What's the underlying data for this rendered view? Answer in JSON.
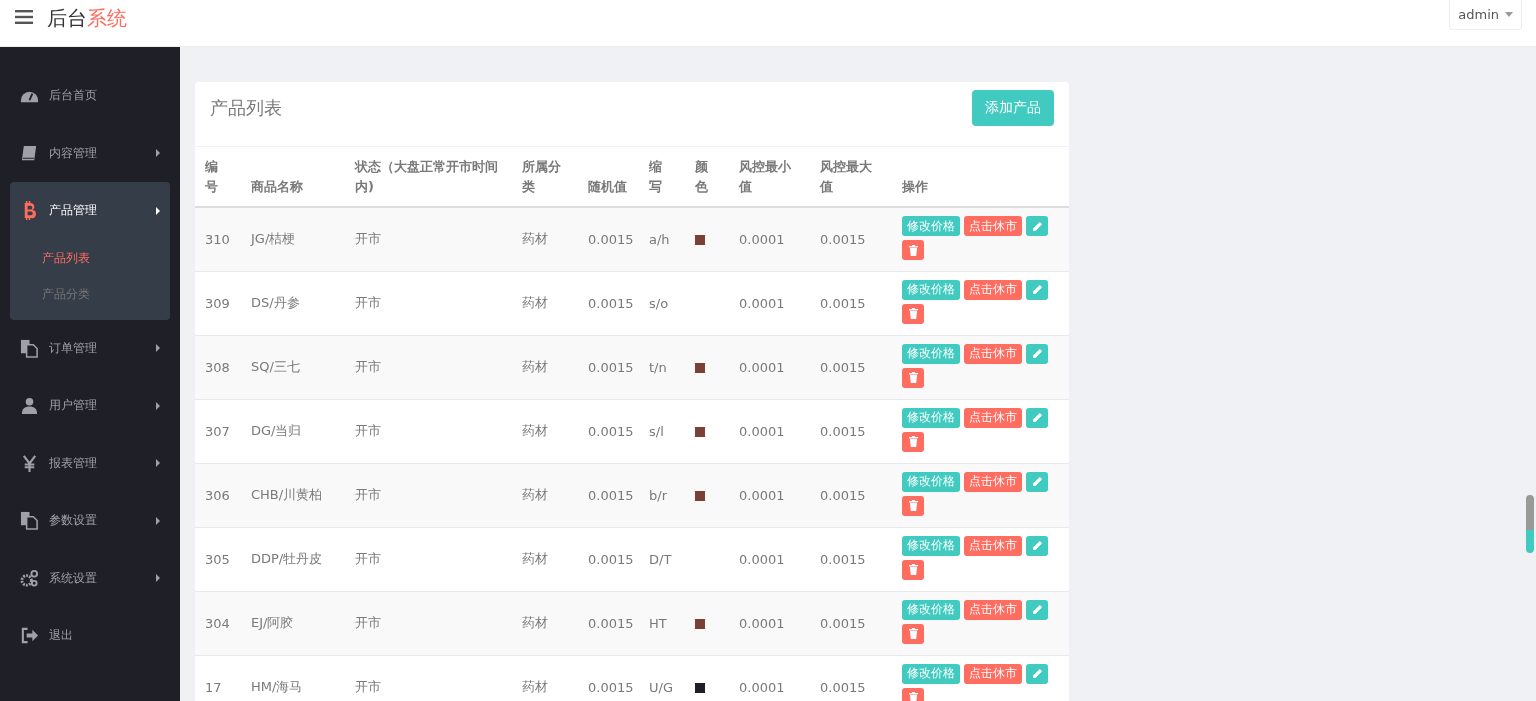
{
  "header": {
    "logo_first": "后台",
    "logo_second": "系统",
    "user": "admin"
  },
  "sidebar": {
    "items": [
      {
        "label": "后台首页",
        "has_arrow": false,
        "expanded": false
      },
      {
        "label": "内容管理",
        "has_arrow": true,
        "expanded": false
      },
      {
        "label": "产品管理",
        "has_arrow": true,
        "expanded": true,
        "children": [
          {
            "label": "产品列表",
            "selected": true
          },
          {
            "label": "产品分类",
            "selected": false
          }
        ]
      },
      {
        "label": "订单管理",
        "has_arrow": true,
        "expanded": false
      },
      {
        "label": "用户管理",
        "has_arrow": true,
        "expanded": false
      },
      {
        "label": "报表管理",
        "has_arrow": true,
        "expanded": false
      },
      {
        "label": "参数设置",
        "has_arrow": true,
        "expanded": false
      },
      {
        "label": "系统设置",
        "has_arrow": true,
        "expanded": false
      },
      {
        "label": "退出",
        "has_arrow": false,
        "expanded": false
      }
    ]
  },
  "panel": {
    "title": "产品列表",
    "add_button": "添加产品",
    "table": {
      "columns": [
        "编号",
        "商品名称",
        "状态（大盘正常开市时间内)",
        "所属分类",
        "随机值",
        "缩写",
        "颜色",
        "风控最小值",
        "风控最大值",
        "操作"
      ],
      "rows": [
        {
          "id": "310",
          "name": "JG/桔梗",
          "status": "开市",
          "category": "药材",
          "random": "0.0015",
          "abbr": "a/h",
          "color": "#7a4236",
          "min": "0.0001",
          "max": "0.0015",
          "edit_price": "修改价格",
          "close_market": "点击休市"
        },
        {
          "id": "309",
          "name": "DS/丹参",
          "status": "开市",
          "category": "药材",
          "random": "0.0015",
          "abbr": "s/o",
          "min": "0.0001",
          "max": "0.0015",
          "edit_price": "修改价格",
          "close_market": "点击休市"
        },
        {
          "id": "308",
          "name": "SQ/三七",
          "status": "开市",
          "category": "药材",
          "random": "0.0015",
          "abbr": "t/n",
          "color": "#7a4236",
          "min": "0.0001",
          "max": "0.0015",
          "edit_price": "修改价格",
          "close_market": "点击休市"
        },
        {
          "id": "307",
          "name": "DG/当归",
          "status": "开市",
          "category": "药材",
          "random": "0.0015",
          "abbr": "s/l",
          "color": "#7a4236",
          "min": "0.0001",
          "max": "0.0015",
          "edit_price": "修改价格",
          "close_market": "点击休市"
        },
        {
          "id": "306",
          "name": "CHB/川黄柏",
          "status": "开市",
          "category": "药材",
          "random": "0.0015",
          "abbr": "b/r",
          "color": "#7a4236",
          "min": "0.0001",
          "max": "0.0015",
          "edit_price": "修改价格",
          "close_market": "点击休市"
        },
        {
          "id": "305",
          "name": "DDP/牡丹皮",
          "status": "开市",
          "category": "药材",
          "random": "0.0015",
          "abbr": "D/T",
          "min": "0.0001",
          "max": "0.0015",
          "edit_price": "修改价格",
          "close_market": "点击休市"
        },
        {
          "id": "304",
          "name": "EJ/阿胶",
          "status": "开市",
          "category": "药材",
          "random": "0.0015",
          "abbr": "HT",
          "color": "#7a4236",
          "min": "0.0001",
          "max": "0.0015",
          "edit_price": "修改价格",
          "close_market": "点击休市"
        },
        {
          "id": "17",
          "name": "HM/海马",
          "status": "开市",
          "category": "药材",
          "random": "0.0015",
          "abbr": "U/G",
          "color": "#1f1f28",
          "min": "0.0001",
          "max": "0.0015",
          "edit_price": "修改价格",
          "close_market": "点击休市"
        }
      ]
    }
  }
}
